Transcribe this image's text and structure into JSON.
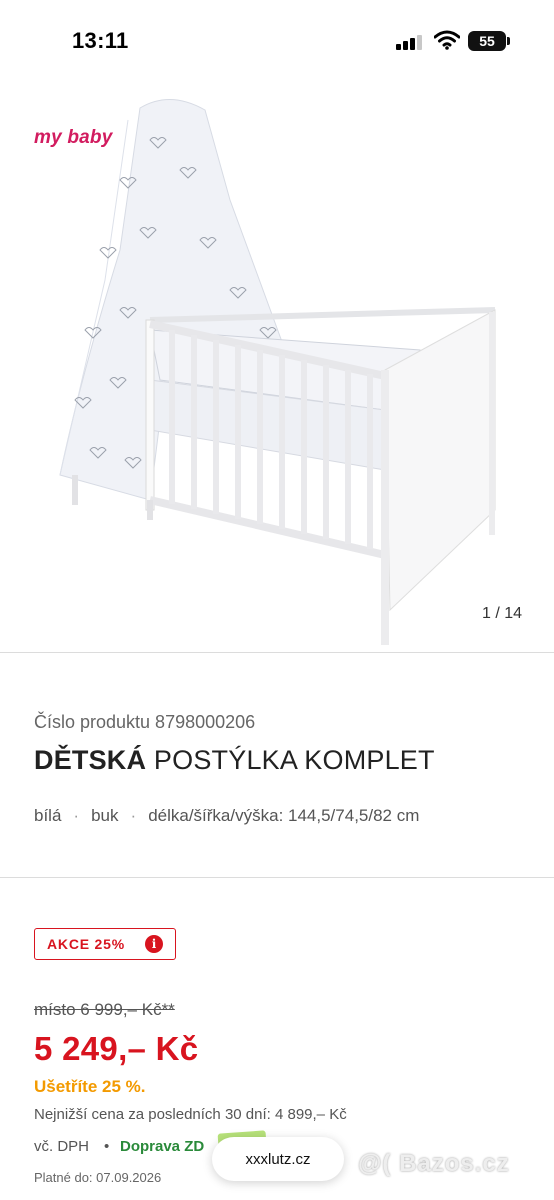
{
  "status_bar": {
    "time": "13:11",
    "battery": "55",
    "signal_icon": "signal-bars-icon",
    "wifi_icon": "wifi-icon"
  },
  "gallery": {
    "brand": "my baby",
    "counter": "1 / 14"
  },
  "product": {
    "number_label": "Číslo produktu 8798000206",
    "title_bold": "DĚTSKÁ",
    "title_rest": " POSTÝLKA KOMPLET",
    "attributes": [
      "bílá",
      "buk",
      "délka/šířka/výška: 144,5/74,5/82 cm"
    ]
  },
  "pricing": {
    "promo_label": "AKCE 25%",
    "info_icon": "i",
    "old_price": "místo 6 999,– Kč**",
    "new_price": "5 249,– Kč",
    "savings": "Ušetříte 25 %.",
    "lowest_price": "Nejnižší cena za posledních 30 dní: 4 899,– Kč",
    "vat": "vč. DPH",
    "dot": "•",
    "delivery": "Doprava ZD",
    "valid_until": "Platné do: 07.09.2026"
  },
  "overlay": {
    "url": "xxxlutz.cz",
    "watermark": "@( Bazos.cz"
  },
  "colors": {
    "accent_red": "#d8141f",
    "savings_orange": "#f39a00",
    "delivery_green": "#2a8a3a",
    "brand_pink": "#d21c5f"
  }
}
